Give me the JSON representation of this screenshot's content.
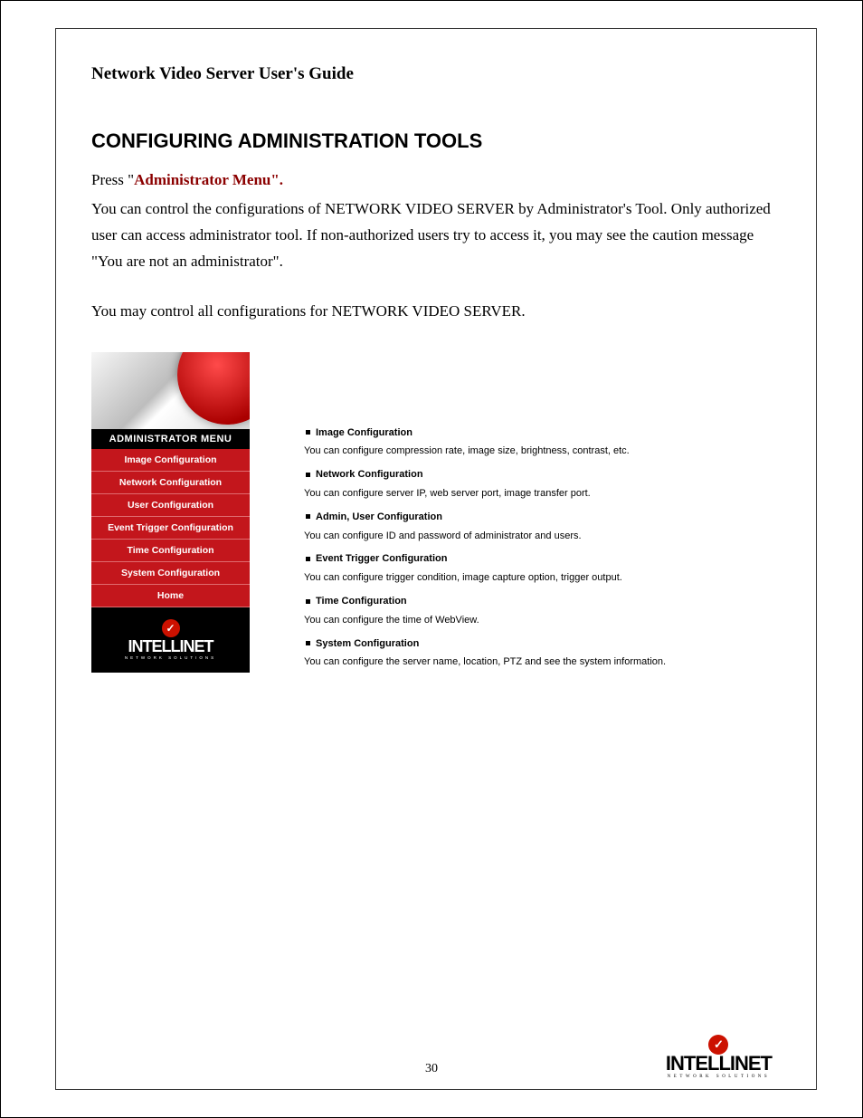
{
  "header": {
    "title": "Network Video Server User's Guide"
  },
  "section": {
    "title": "CONFIGURING ADMINISTRATION TOOLS"
  },
  "press": {
    "prefix": "Press \"",
    "link": "Administrator Menu",
    "suffix": "\"."
  },
  "paragraph1": "You can control the configurations of NETWORK VIDEO SERVER by Administrator's Tool. Only authorized user can access administrator tool. If non-authorized users try to access it, you may see the caution message \"You are not an administrator\".",
  "paragraph2": "You may control all configurations for NETWORK VIDEO SERVER.",
  "admin_menu": {
    "title": "ADMINISTRATOR MENU",
    "items": [
      "Image Configuration",
      "Network Configuration",
      "User Configuration",
      "Event Trigger Configuration",
      "Time Configuration",
      "System Configuration",
      "Home"
    ]
  },
  "brand": {
    "name": "INTELLINET",
    "sub": "NETWORK SOLUTIONS",
    "check": "✓"
  },
  "descriptions": [
    {
      "title": "Image Configuration",
      "text": "You can configure compression rate, image size, brightness, contrast, etc."
    },
    {
      "title": "Network Configuration",
      "text": "You can configure server IP, web server port, image transfer port."
    },
    {
      "title": "Admin, User Configuration",
      "text": "You can configure ID and password of administrator and users."
    },
    {
      "title": "Event Trigger Configuration",
      "text": "You can configure trigger condition, image capture option, trigger output."
    },
    {
      "title": "Time Configuration",
      "text": "You can configure the time of WebView."
    },
    {
      "title": "System Configuration",
      "text": "You can configure the server name, location, PTZ and see the system information."
    }
  ],
  "footer": {
    "page_number": "30"
  }
}
